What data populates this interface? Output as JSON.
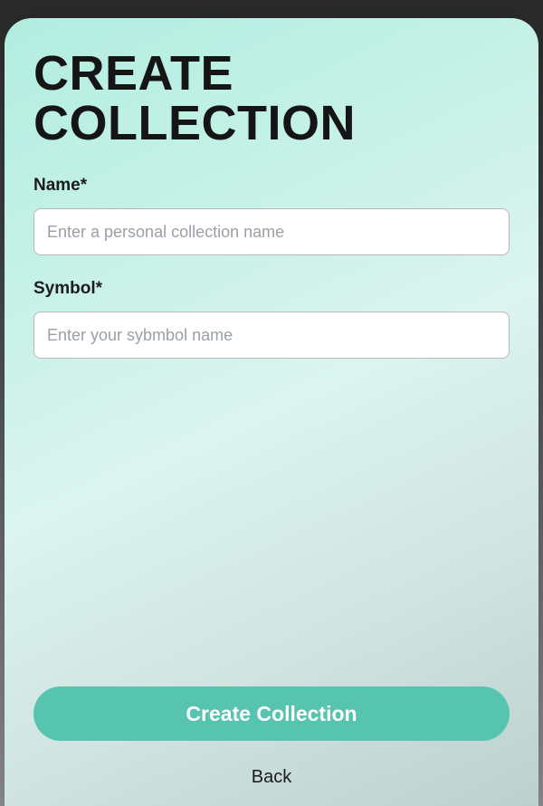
{
  "modal": {
    "title": "CREATE COLLECTION",
    "fields": {
      "name": {
        "label": "Name*",
        "placeholder": "Enter a personal collection name",
        "value": ""
      },
      "symbol": {
        "label": "Symbol*",
        "placeholder": "Enter your sybmbol name",
        "value": ""
      }
    },
    "primary_action_label": "Create Collection",
    "secondary_action_label": "Back"
  },
  "colors": {
    "primary_button": "#56c4ae"
  }
}
